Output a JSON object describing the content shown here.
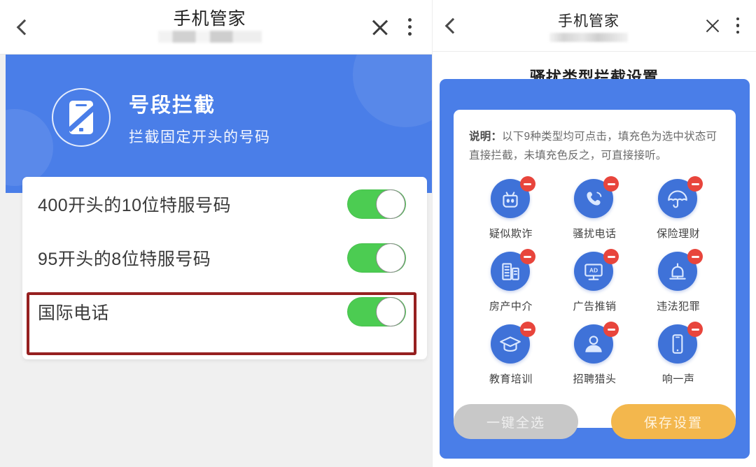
{
  "left_panel": {
    "topbar": {
      "back_icon": "chevron-left-icon",
      "title": "手机管家",
      "subtitle_blurred": "",
      "close_icon": "close-icon",
      "menu_icon": "more-vertical-icon"
    },
    "banner": {
      "icon": "phone-blocked-icon",
      "title": "号段拦截",
      "subtitle": "拦截固定开头的号码",
      "background_color": "#4a7ee8"
    },
    "rows": [
      {
        "label": "400开头的10位特服号码",
        "toggle_state": "on",
        "highlighted": false
      },
      {
        "label": "95开头的8位特服号码",
        "toggle_state": "on",
        "highlighted": false
      },
      {
        "label": "国际电话",
        "toggle_state": "on",
        "highlighted": true
      }
    ],
    "highlight_color": "#962020",
    "toggle_on_color": "#4ccc52"
  },
  "right_panel": {
    "topbar": {
      "back_icon": "chevron-left-icon",
      "title": "手机管家",
      "subtitle_blurred": "",
      "close_icon": "close-icon",
      "menu_icon": "more-vertical-icon"
    },
    "heading": "骚扰类型拦截设置",
    "description_label": "说明：",
    "description_body": "以下9种类型均可点击，填充色为选中状态可直接拦截，未填充色反之，可直接接听。",
    "categories": [
      {
        "label": "疑似欺诈",
        "icon": "fraud-mask-icon",
        "selected": true,
        "badge": "minus-badge"
      },
      {
        "label": "骚扰电话",
        "icon": "phone-ring-icon",
        "selected": true,
        "badge": "minus-badge"
      },
      {
        "label": "保险理财",
        "icon": "umbrella-icon",
        "selected": true,
        "badge": "minus-badge"
      },
      {
        "label": "房产中介",
        "icon": "building-icon",
        "selected": true,
        "badge": "minus-badge"
      },
      {
        "label": "广告推销",
        "icon": "ad-monitor-icon",
        "selected": true,
        "badge": "minus-badge"
      },
      {
        "label": "违法犯罪",
        "icon": "siren-alarm-icon",
        "selected": true,
        "badge": "minus-badge"
      },
      {
        "label": "教育培训",
        "icon": "graduation-cap-icon",
        "selected": true,
        "badge": "minus-badge"
      },
      {
        "label": "招聘猎头",
        "icon": "person-badge-icon",
        "selected": true,
        "badge": "minus-badge"
      },
      {
        "label": "响一声",
        "icon": "mobile-phone-icon",
        "selected": true,
        "badge": "minus-badge"
      }
    ],
    "buttons": {
      "select_all": "一键全选",
      "save": "保存设置",
      "select_all_color": "#c8c8c8",
      "save_color": "#f3b74d"
    },
    "card_color": "#4a7ee8",
    "icon_circle_color": "#3f72d8",
    "badge_color": "#e8453c"
  }
}
